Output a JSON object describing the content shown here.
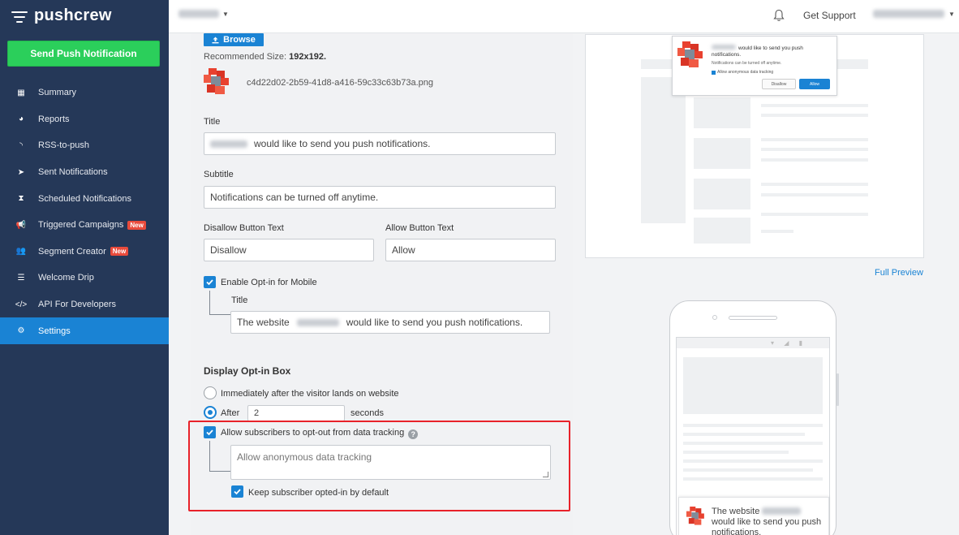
{
  "app": {
    "name": "pushcrew"
  },
  "sidebar": {
    "send_button": "Send Push Notification",
    "items": [
      {
        "label": "Summary",
        "icon": "grid-icon",
        "glyph": "▦"
      },
      {
        "label": "Reports",
        "icon": "pie-chart-icon",
        "glyph": "◕"
      },
      {
        "label": "RSS-to-push",
        "icon": "rss-icon",
        "glyph": "◝"
      },
      {
        "label": "Sent Notifications",
        "icon": "paper-plane-icon",
        "glyph": "➤"
      },
      {
        "label": "Scheduled Notifications",
        "icon": "hourglass-icon",
        "glyph": "⧗"
      },
      {
        "label": "Triggered Campaigns",
        "icon": "megaphone-icon",
        "glyph": "📢",
        "badge": "New"
      },
      {
        "label": "Segment Creator",
        "icon": "users-icon",
        "glyph": "👥",
        "badge": "New"
      },
      {
        "label": "Welcome Drip",
        "icon": "list-icon",
        "glyph": "☰"
      },
      {
        "label": "API For Developers",
        "icon": "code-icon",
        "glyph": "</>"
      },
      {
        "label": "Settings",
        "icon": "gear-icon",
        "glyph": "⚙",
        "active": true
      }
    ]
  },
  "topbar": {
    "support": "Get Support"
  },
  "form": {
    "browse_label": "Browse",
    "recommended_label": "Recommended Size:",
    "recommended_value": "192x192.",
    "filename": "c4d22d02-2b59-41d8-a416-59c33c63b73a.png",
    "title_label": "Title",
    "title_value": "would like to send you push notifications.",
    "subtitle_label": "Subtitle",
    "subtitle_value": "Notifications can be turned off anytime.",
    "disallow_label": "Disallow Button Text",
    "disallow_value": "Disallow",
    "allow_label": "Allow Button Text",
    "allow_value": "Allow",
    "mobile_optin_label": "Enable Opt-in for Mobile",
    "mobile_title_label": "Title",
    "mobile_title_prefix": "The website",
    "mobile_title_suffix": "would like to send you push notifications.",
    "display_section": "Display Opt-in Box",
    "radio_immediate": "Immediately after the visitor lands on website",
    "radio_after": "After",
    "after_seconds": "2",
    "seconds_label": "seconds",
    "optout_label": "Allow subscribers to opt-out from data tracking",
    "optout_text": "Allow anonymous data tracking",
    "keep_optin_label": "Keep subscriber opted-in by default"
  },
  "preview": {
    "popup_title": "would like to send you push notifications.",
    "popup_sub": "Notifications can be turned off anytime.",
    "popup_check": "Allow anonymous data tracking",
    "popup_disallow": "Disallow",
    "popup_allow": "Allow",
    "full_preview": "Full Preview",
    "mobile_prefix": "The website",
    "mobile_suffix": "would like to send you push notifications."
  },
  "colors": {
    "sidebar": "#253858",
    "accent": "#1a83d4",
    "send_button": "#2bcf5b",
    "highlight": "#e8222a",
    "badge": "#e94b3c"
  }
}
